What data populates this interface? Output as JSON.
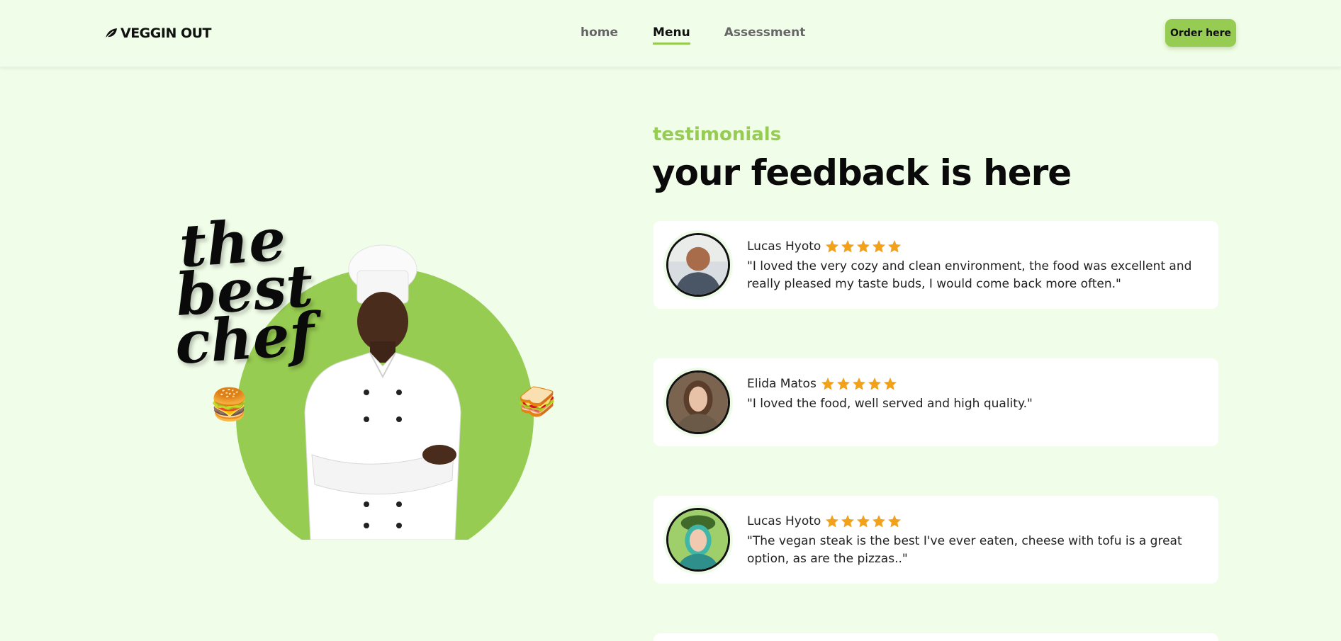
{
  "header": {
    "logo_text": "VEGGIN OUT",
    "nav": [
      {
        "label": "home"
      },
      {
        "label": "Menu"
      },
      {
        "label": "Assessment"
      }
    ],
    "order_label": "Order here"
  },
  "hero": {
    "lines": [
      "the",
      "best",
      "chef"
    ],
    "left_food": "🍔",
    "right_food": "🥪",
    "accent_color": "#97cc52"
  },
  "testimonials": {
    "eyebrow": "testimonials",
    "heading": "your feedback is here",
    "items": [
      {
        "name": "Lucas Hyoto",
        "rating": 5,
        "quote": "\"I loved the very cozy and clean environment, the food was excellent and really pleased my taste buds, I would come back more often.\""
      },
      {
        "name": "Elida Matos",
        "rating": 5,
        "quote": "\"I loved the food, well served and high quality.\""
      },
      {
        "name": "Lucas Hyoto",
        "rating": 5,
        "quote": "\"The vegan steak is the best I've ever eaten, cheese with tofu is a great option, as are the pizzas..\""
      }
    ]
  },
  "colors": {
    "background": "#f0fde8",
    "accent": "#97cc52",
    "star": "#f2a11a"
  }
}
